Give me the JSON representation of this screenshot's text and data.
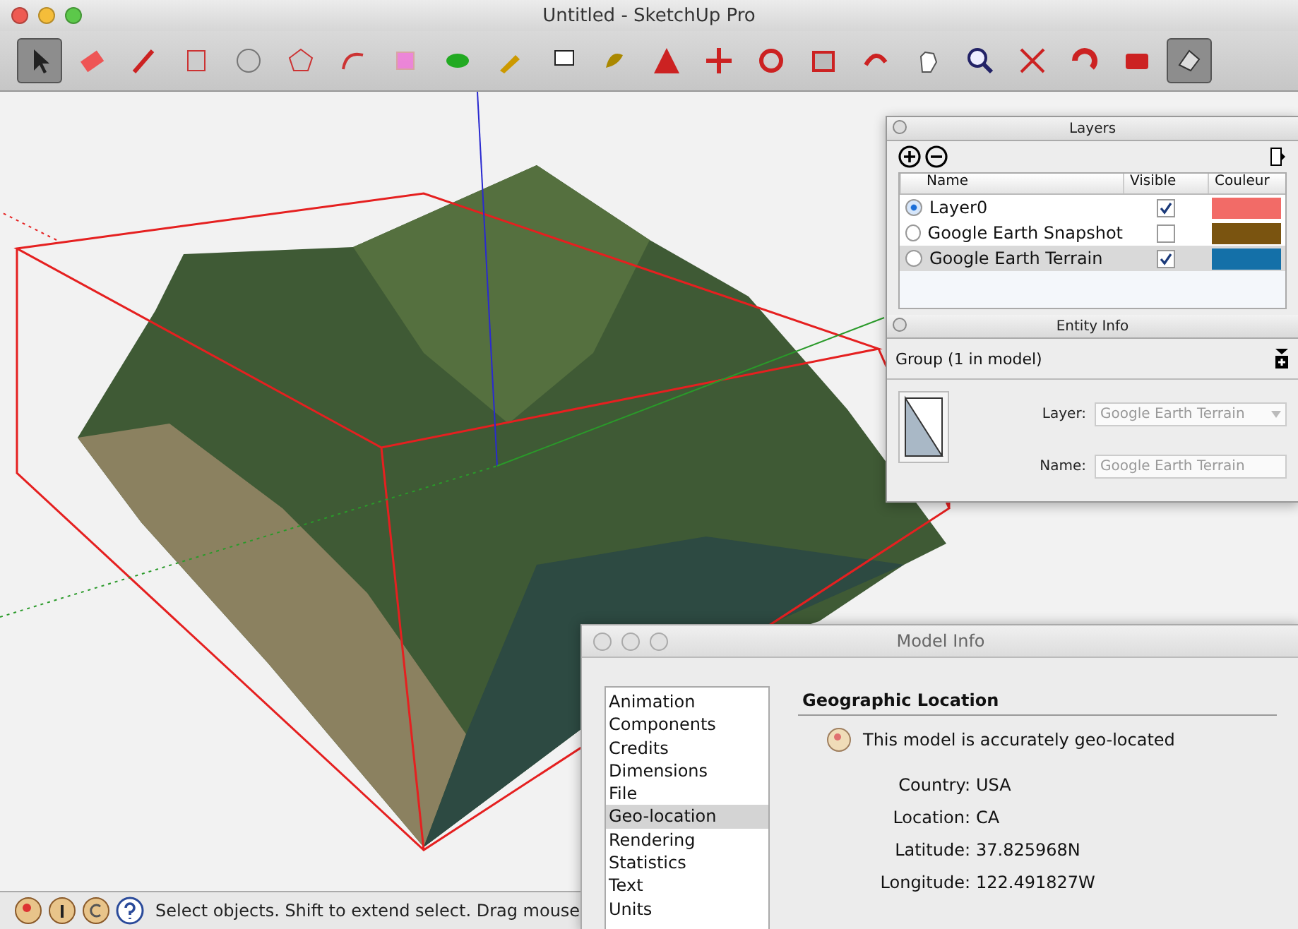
{
  "window": {
    "title": "Untitled - SketchUp Pro"
  },
  "tools": [
    {
      "selected": true
    },
    {
      "selected": false
    },
    {
      "selected": false
    },
    {
      "selected": false
    },
    {
      "selected": false
    },
    {
      "selected": false
    },
    {
      "selected": false
    },
    {
      "selected": false
    },
    {
      "selected": false
    },
    {
      "selected": false
    },
    {
      "selected": false
    },
    {
      "selected": false
    },
    {
      "selected": false
    },
    {
      "selected": false
    },
    {
      "selected": false
    },
    {
      "selected": false
    },
    {
      "selected": false
    },
    {
      "selected": false
    },
    {
      "selected": false
    },
    {
      "selected": false
    },
    {
      "selected": false
    },
    {
      "selected": false
    },
    {
      "selected": true
    }
  ],
  "layers": {
    "title": "Layers",
    "columns": [
      "Name",
      "Visible",
      "Couleur"
    ],
    "rows": [
      {
        "name": "Layer0",
        "selected": true,
        "visible": true,
        "color": "#f26b67"
      },
      {
        "name": "Google Earth Snapshot",
        "selected": false,
        "visible": false,
        "color": "#7a5410"
      },
      {
        "name": "Google Earth Terrain",
        "selected": false,
        "visible": true,
        "color": "#1470a8"
      }
    ]
  },
  "entity_info": {
    "title": "Entity Info",
    "summary": "Group (1 in model)",
    "fields": [
      {
        "label": "Layer:",
        "value": "Google Earth Terrain",
        "kind": "select",
        "disabled": true
      },
      {
        "label": "Name:",
        "value": "Google Earth Terrain",
        "kind": "text",
        "disabled": true
      }
    ]
  },
  "model_info": {
    "title": "Model Info",
    "items": [
      {
        "label": "Animation",
        "selected": false
      },
      {
        "label": "Components",
        "selected": false
      },
      {
        "label": "Credits",
        "selected": false
      },
      {
        "label": "Dimensions",
        "selected": false
      },
      {
        "label": "File",
        "selected": false
      },
      {
        "label": "Geo-location",
        "selected": true
      },
      {
        "label": "Rendering",
        "selected": false
      },
      {
        "label": "Statistics",
        "selected": false
      },
      {
        "label": "Text",
        "selected": false
      },
      {
        "label": "Units",
        "selected": false
      }
    ],
    "heading": "Geographic Location",
    "status": "This model is accurately geo-located",
    "details": [
      {
        "label": "Country:",
        "value": "USA"
      },
      {
        "label": "Location:",
        "value": "CA"
      },
      {
        "label": "Latitude:",
        "value": "37.825968N"
      },
      {
        "label": "Longitude:",
        "value": "122.491827W"
      }
    ]
  },
  "status_bar": {
    "message": "Select objects. Shift to extend select. Drag mouse"
  }
}
